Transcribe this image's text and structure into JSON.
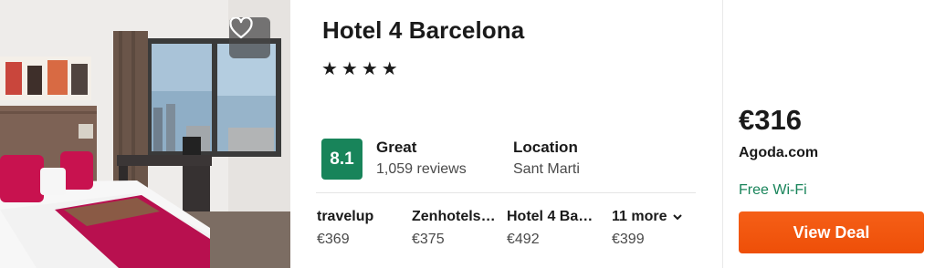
{
  "hotel": {
    "name": "Hotel 4 Barcelona",
    "stars": "★★★★",
    "star_count": 4
  },
  "rating": {
    "score": "8.1",
    "label": "Great",
    "reviews": "1,059 reviews",
    "color": "#18845a"
  },
  "location": {
    "title": "Location",
    "value": "Sant Marti"
  },
  "providers": [
    {
      "name": "travelup",
      "price": "€369"
    },
    {
      "name": "Zenhotels.com",
      "price": "€375"
    },
    {
      "name": "Hotel 4 Barcelona",
      "price": "€492"
    }
  ],
  "more": {
    "label": "11 more",
    "price": "€399"
  },
  "deal": {
    "price": "€316",
    "site": "Agoda.com",
    "perk": "Free Wi-Fi",
    "button": "View Deal",
    "button_color": "#f2560e",
    "perk_color": "#18845a"
  },
  "icons": {
    "favorite": "heart-outline-icon",
    "more": "chevron-down-icon"
  }
}
